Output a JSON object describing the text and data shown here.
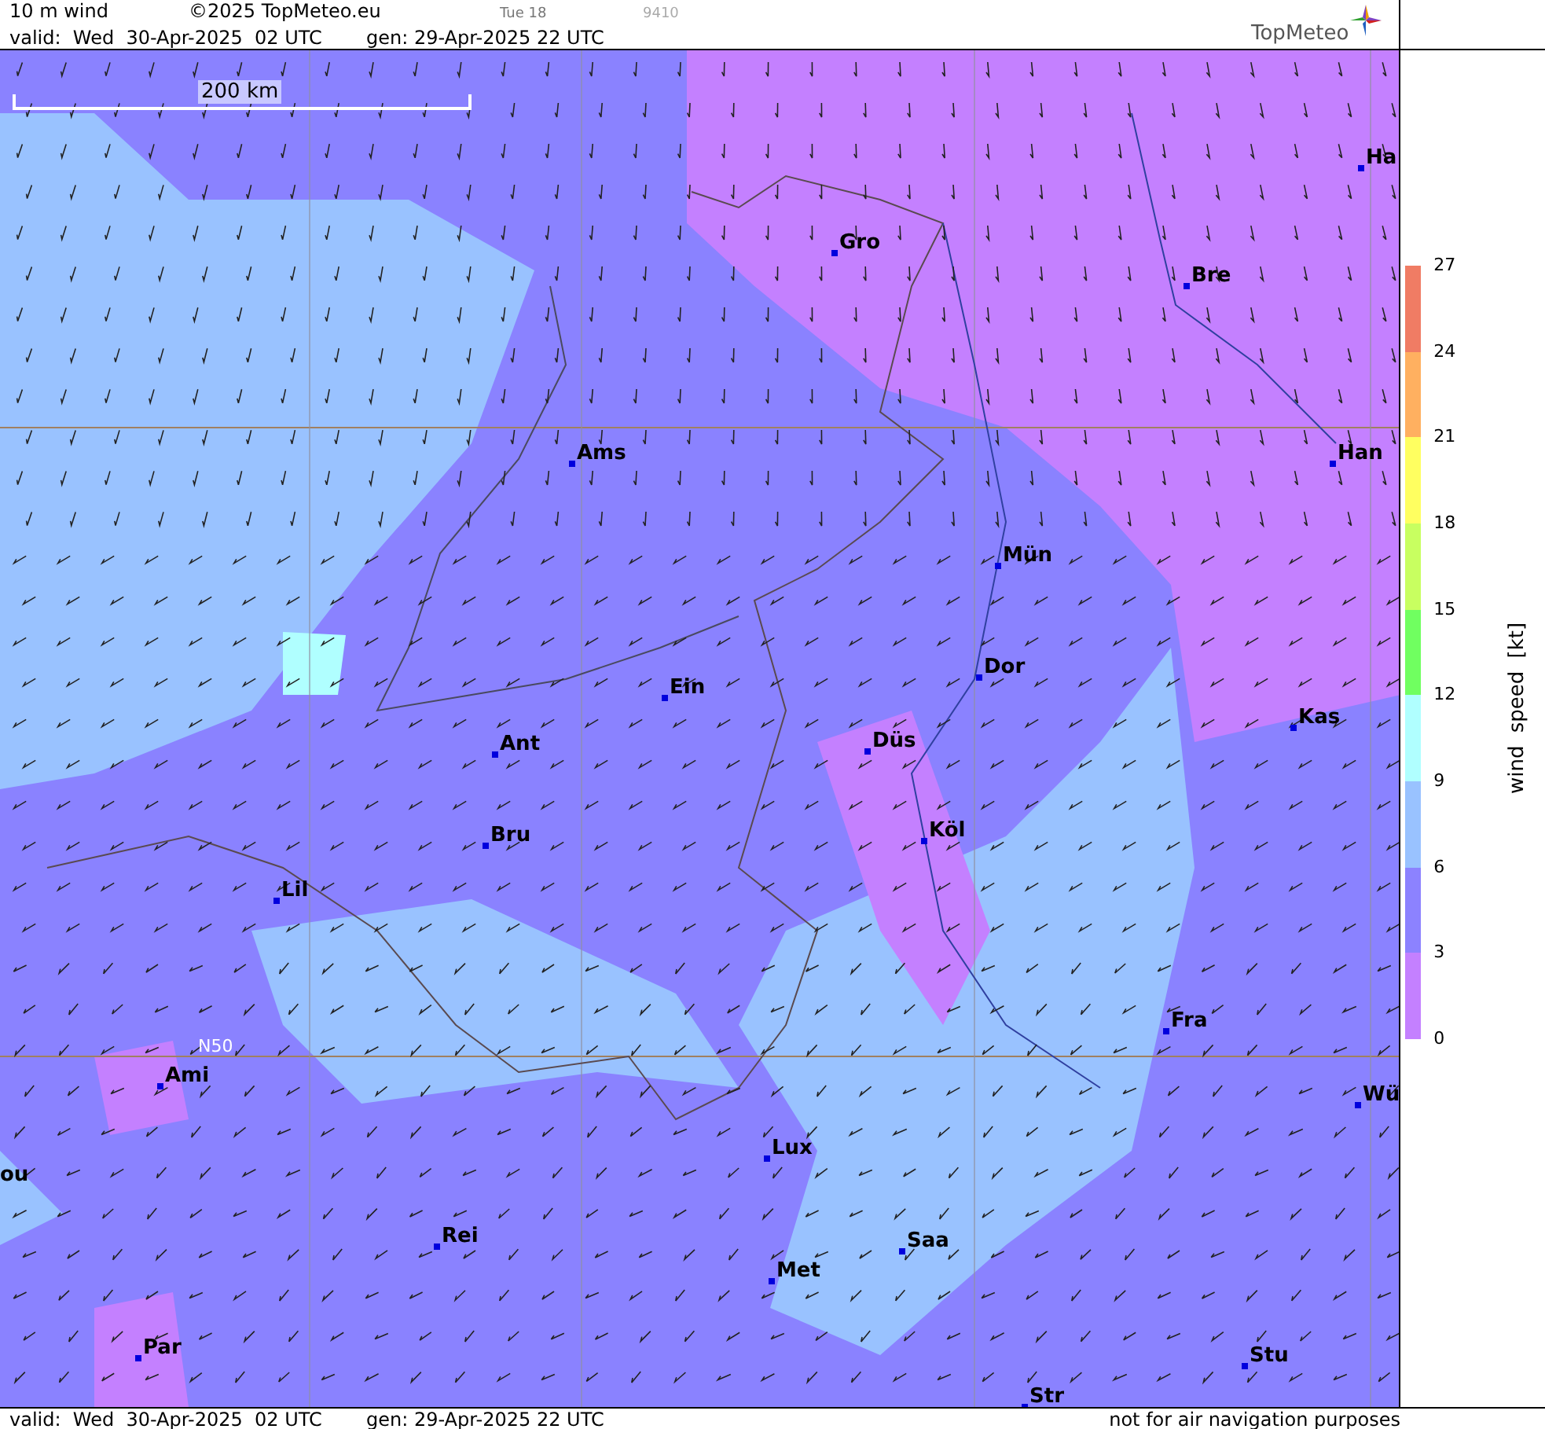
{
  "header": {
    "title": "10 m wind",
    "copyright": "©2025 TopMeteo.eu",
    "day": "Tue 18",
    "code": "9410",
    "valid": "valid:  Wed  30-Apr-2025  02 UTC",
    "gen": "gen: 29-Apr-2025 22 UTC",
    "logo": "TopMeteo"
  },
  "map": {
    "scale": "200 km",
    "latitude_label": "N50",
    "cities": [
      {
        "name": "Ha"
      },
      {
        "name": "Gro"
      },
      {
        "name": "Bre"
      },
      {
        "name": "Ams"
      },
      {
        "name": "Han"
      },
      {
        "name": "Mün"
      },
      {
        "name": "Dor"
      },
      {
        "name": "Ein"
      },
      {
        "name": "Kas"
      },
      {
        "name": "Ant"
      },
      {
        "name": "Düs"
      },
      {
        "name": "Köl"
      },
      {
        "name": "Bru"
      },
      {
        "name": "Lil"
      },
      {
        "name": "Fra"
      },
      {
        "name": "Ami"
      },
      {
        "name": "Wü"
      },
      {
        "name": "Lux"
      },
      {
        "name": "ou"
      },
      {
        "name": "Rei"
      },
      {
        "name": "Saa"
      },
      {
        "name": "Met"
      },
      {
        "name": "Par"
      },
      {
        "name": "Stu"
      },
      {
        "name": "Str"
      }
    ]
  },
  "legend": {
    "title": "wind speed [kt]",
    "ticks": [
      "27",
      "24",
      "21",
      "18",
      "15",
      "12",
      "9",
      "6",
      "3",
      "0"
    ],
    "bands": [
      {
        "color": "#f07c64"
      },
      {
        "color": "#ffb060"
      },
      {
        "color": "#ffff60"
      },
      {
        "color": "#c8ff60"
      },
      {
        "color": "#70ff60"
      },
      {
        "color": "#b0ffff"
      },
      {
        "color": "#99c2ff"
      },
      {
        "color": "#8c82ff"
      },
      {
        "color": "#c480ff"
      }
    ]
  },
  "footer": {
    "valid": "valid:  Wed  30-Apr-2025  02 UTC",
    "gen": "gen: 29-Apr-2025 22 UTC",
    "notice": "not for air navigation purposes"
  }
}
